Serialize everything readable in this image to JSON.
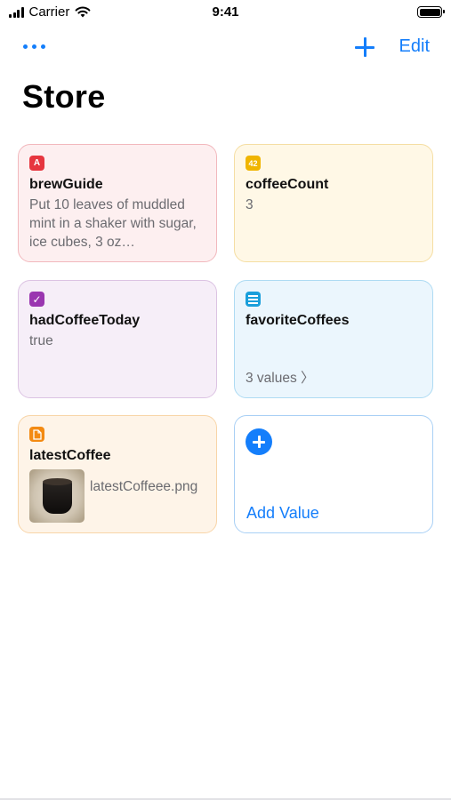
{
  "status_bar": {
    "carrier": "Carrier",
    "time": "9:41"
  },
  "nav": {
    "edit_label": "Edit"
  },
  "title": "Store",
  "cards": {
    "brew": {
      "icon": "A",
      "key": "brewGuide",
      "value": "Put 10 leaves of muddled mint in a shaker with sugar, ice cubes, 3 oz…",
      "color": "#e6363f"
    },
    "count": {
      "icon": "42",
      "key": "coffeeCount",
      "value": "3",
      "color": "#f0b500"
    },
    "had": {
      "icon": "✓",
      "key": "hadCoffeeToday",
      "value": "true",
      "color": "#9a36b0"
    },
    "fav": {
      "icon": "list-icon",
      "key": "favoriteCoffees",
      "values_label": "3 values 〉",
      "color": "#1a9fdb"
    },
    "latest": {
      "icon": "document-icon",
      "key": "latestCoffee",
      "filename": "latestCoffeee.png",
      "color": "#f38a12"
    },
    "add": {
      "label": "Add Value"
    }
  },
  "accent_color": "#147EFB"
}
